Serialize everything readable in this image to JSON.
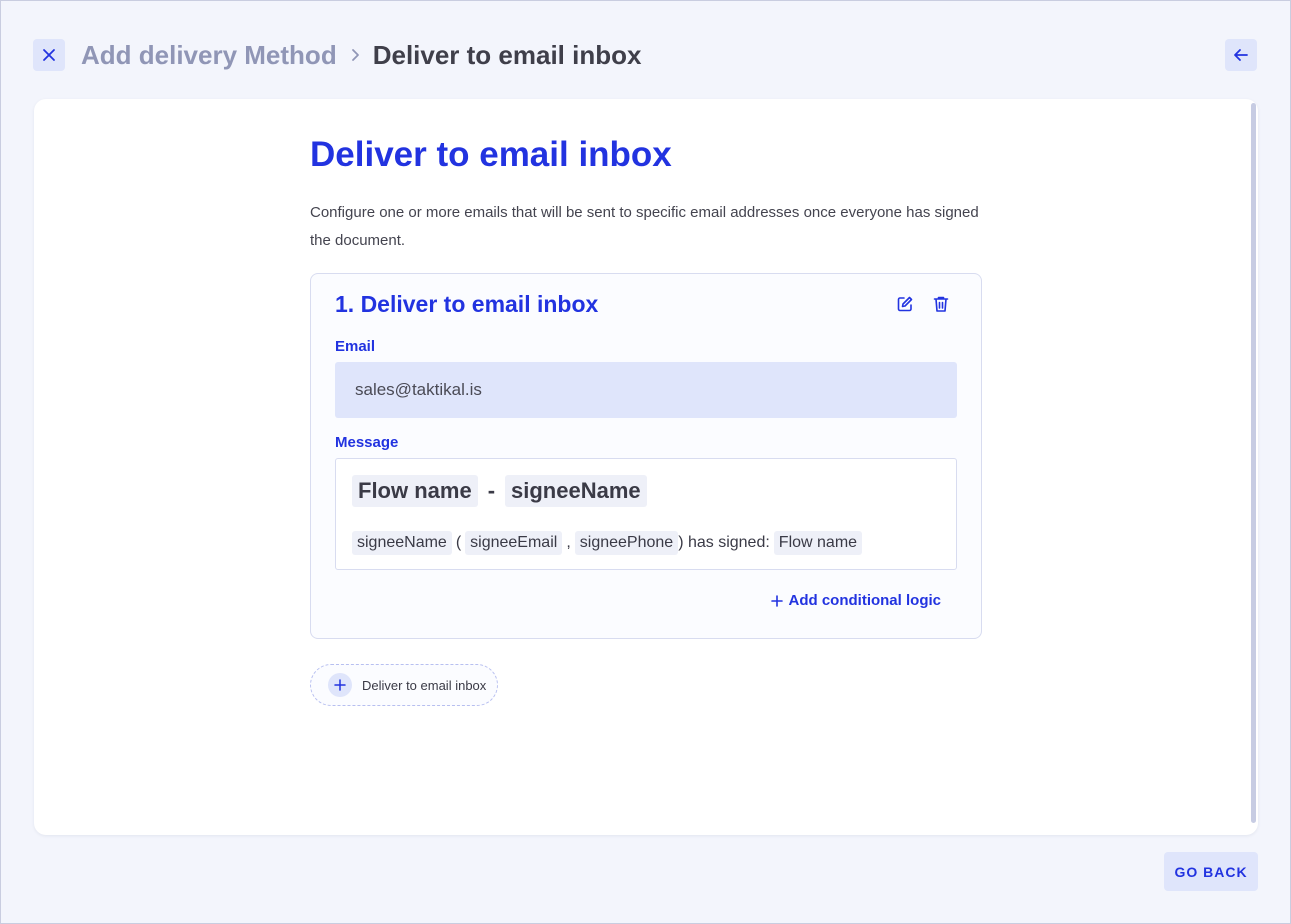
{
  "header": {
    "close_icon": "close-icon",
    "breadcrumb_parent": "Add delivery Method",
    "breadcrumb_current": "Deliver to email inbox",
    "back_icon": "arrow-left-icon"
  },
  "main": {
    "title": "Deliver to email inbox",
    "description": "Configure one or more emails that will be sent to specific email addresses once everyone has signed the document.",
    "card": {
      "title": "1. Deliver to email inbox",
      "edit_icon": "edit-icon",
      "delete_icon": "trash-icon",
      "email_label": "Email",
      "email_value": "sales@taktikal.is",
      "message_label": "Message",
      "message": {
        "subject_chip_1": "Flow name",
        "subject_sep": "-",
        "subject_chip_2": "signeeName",
        "body_chip_name": "signeeName",
        "body_open": "(",
        "body_chip_email": "signeeEmail",
        "body_comma": ",",
        "body_chip_phone": "signeePhone",
        "body_text": ") has signed:",
        "body_chip_flow": "Flow name"
      },
      "add_logic_label": "Add conditional logic"
    },
    "add_delivery_label": "Deliver to email inbox"
  },
  "footer": {
    "go_back_label": "GO BACK"
  },
  "colors": {
    "accent": "#2233e0",
    "chip_bg": "#dfe5fb",
    "background": "#f3f5fc"
  }
}
